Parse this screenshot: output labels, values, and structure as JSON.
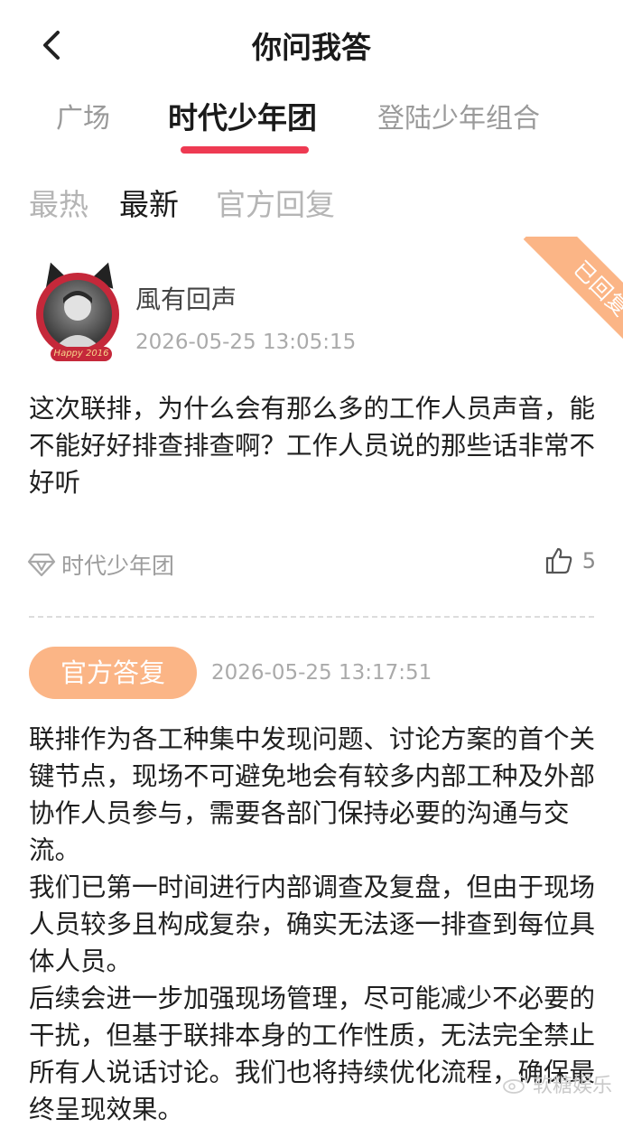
{
  "header": {
    "title": "你问我答",
    "back_icon": "chevron-left-icon"
  },
  "tabs": [
    {
      "label": "广场",
      "active": false
    },
    {
      "label": "时代少年团",
      "active": true
    },
    {
      "label": "登陆少年组合",
      "active": false
    }
  ],
  "accent_color": "#ee3a52",
  "subtabs": [
    {
      "label": "最热",
      "active": false
    },
    {
      "label": "最新",
      "active": true
    },
    {
      "label": "官方回复",
      "active": false
    }
  ],
  "post": {
    "status_ribbon": "已回复",
    "status_color": "#fbb586",
    "username": "風有回声",
    "timestamp": "2026-05-25 13:05:15",
    "avatar_badge_text": "Happy 2016",
    "question": "这次联排，为什么会有那么多的工作人员声音，能不能好好排查排查啊？工作人员说的那些话非常不好听",
    "group_tag": "时代少年团",
    "like_count": "5"
  },
  "reply": {
    "badge": "官方答复",
    "timestamp": "2026-05-25 13:17:51",
    "paragraphs": [
      "联排作为各工种集中发现问题、讨论方案的首个关键节点，现场不可避免地会有较多内部工种及外部协作人员参与，需要各部门保持必要的沟通与交流。",
      "我们已第一时间进行内部调查及复盘，但由于现场人员较多且构成复杂，确实无法逐一排查到每位具体人员。",
      "后续会进一步加强现场管理，尽可能减少不必要的干扰，但基于联排本身的工作性质，无法完全禁止所有人说话讨论。我们也将持续优化流程，确保最终呈现效果。"
    ]
  },
  "watermark": {
    "text": "软糖娱乐",
    "icon": "weibo-icon"
  }
}
